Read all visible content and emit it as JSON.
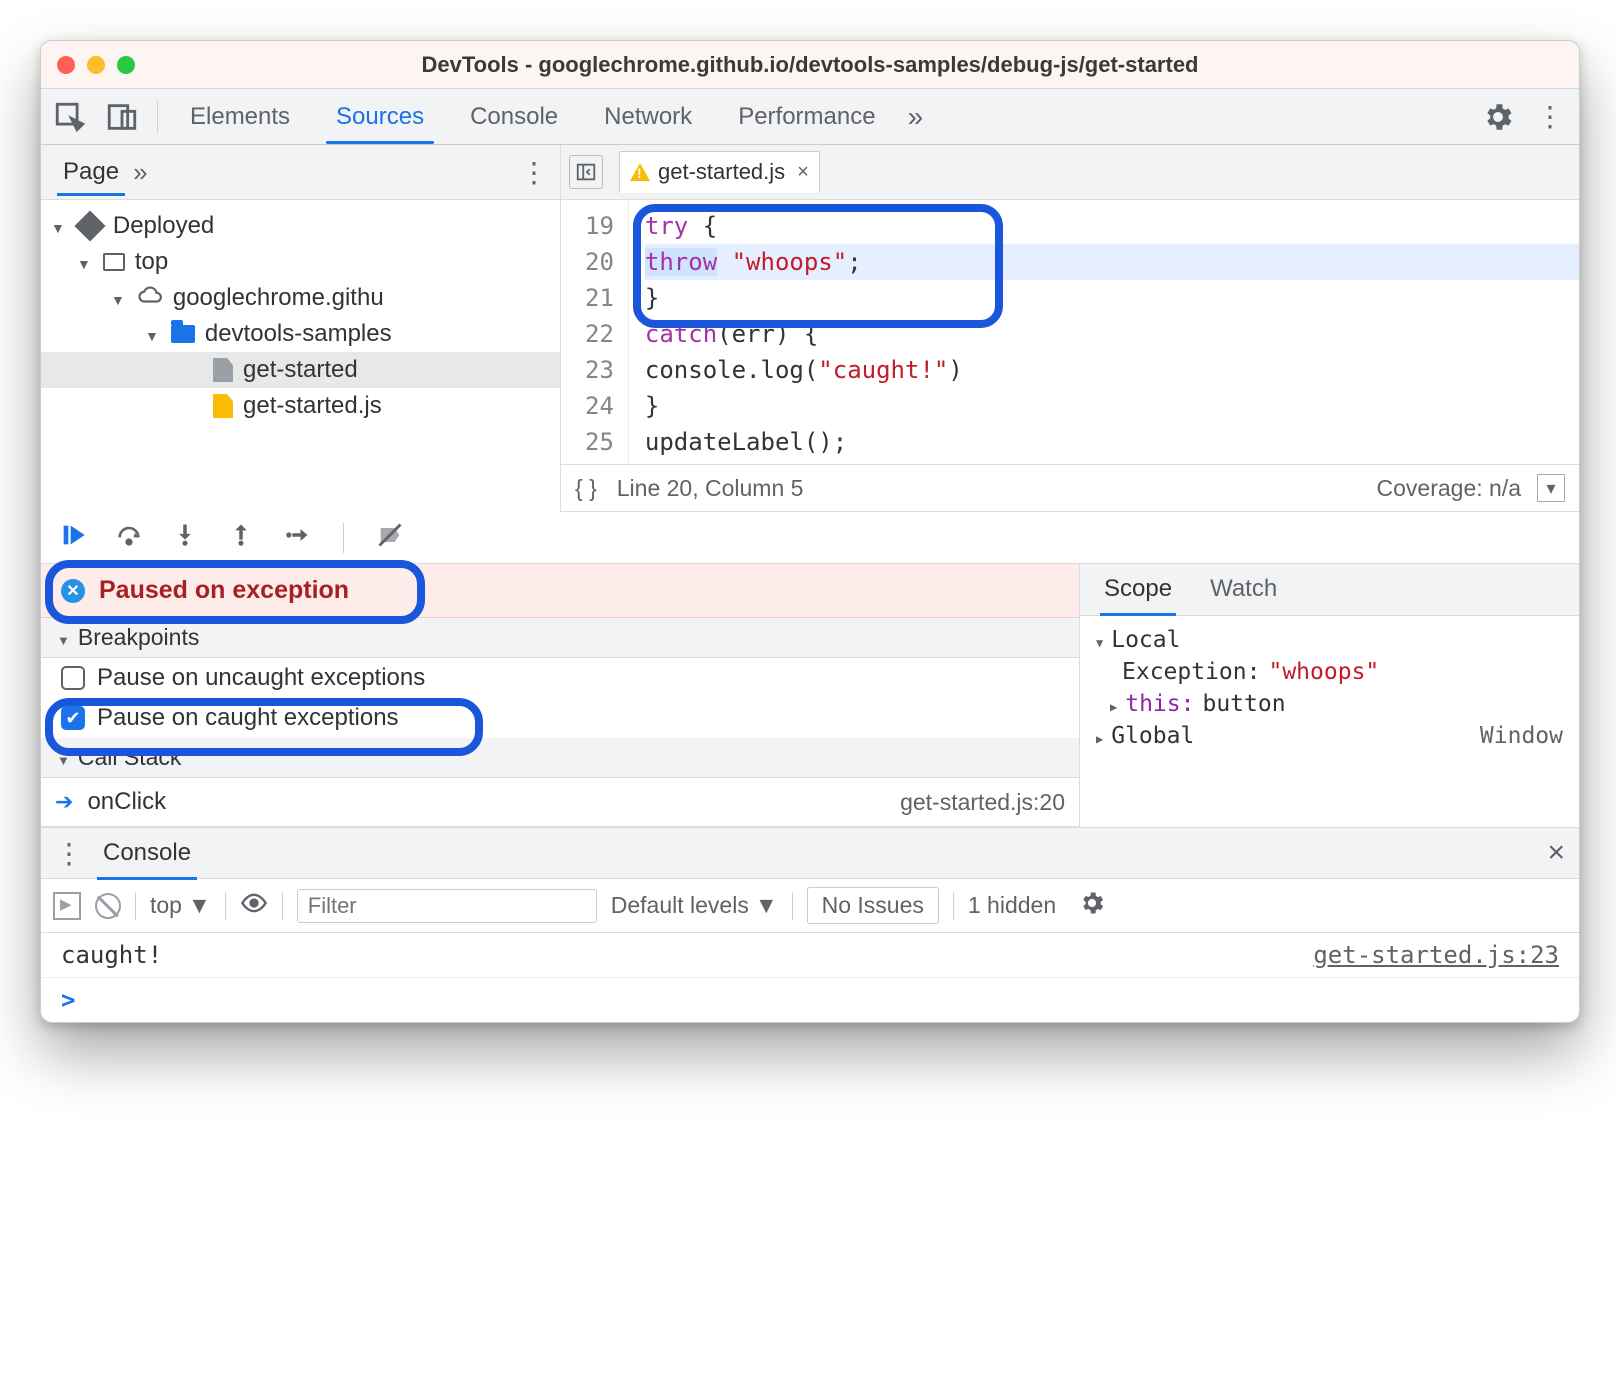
{
  "window": {
    "title": "DevTools - googlechrome.github.io/devtools-samples/debug-js/get-started"
  },
  "tabs": {
    "elements": "Elements",
    "sources": "Sources",
    "console": "Console",
    "network": "Network",
    "performance": "Performance",
    "more": "»"
  },
  "sources_sidebar": {
    "page_tab": "Page",
    "more": "»",
    "tree": {
      "deployed": "Deployed",
      "top": "top",
      "origin": "googlechrome.githu",
      "folder": "devtools-samples",
      "file_html": "get-started",
      "file_js": "get-started.js"
    }
  },
  "open_file": {
    "name": "get-started.js",
    "close": "×"
  },
  "editor": {
    "lines": [
      19,
      20,
      21,
      22,
      23,
      24,
      25
    ],
    "code": {
      "l19a": "try",
      "l19b": " {",
      "l20a": "throw",
      "l20b": " ",
      "l20c": "\"whoops\"",
      "l20d": ";",
      "l21": "}",
      "l22a": "catch",
      "l22b": "(err) {",
      "l23a": "  console.log(",
      "l23b": "\"caught!\"",
      "l23c": ")",
      "l24": "}",
      "l25": "updateLabel();"
    },
    "status_line": "Line 20, Column 5",
    "coverage": "Coverage: n/a",
    "braces": "{ }"
  },
  "debugger": {
    "paused_label": "Paused on exception",
    "breakpoints_header": "Breakpoints",
    "pause_uncaught": "Pause on uncaught exceptions",
    "pause_caught": "Pause on caught exceptions",
    "callstack_header": "Call Stack",
    "frame": {
      "name": "onClick",
      "location": "get-started.js:20"
    }
  },
  "scope": {
    "tab_scope": "Scope",
    "tab_watch": "Watch",
    "local": "Local",
    "exception_key": "Exception:",
    "exception_val": "\"whoops\"",
    "this_key": "this:",
    "this_val": "button",
    "global": "Global",
    "global_val": "Window"
  },
  "drawer": {
    "tab": "Console",
    "close": "×",
    "context": "top",
    "filter_placeholder": "Filter",
    "levels": "Default levels",
    "issues": "No Issues",
    "hidden": "1 hidden"
  },
  "console": {
    "msg": "caught!",
    "link": "get-started.js:23",
    "prompt": ">"
  }
}
